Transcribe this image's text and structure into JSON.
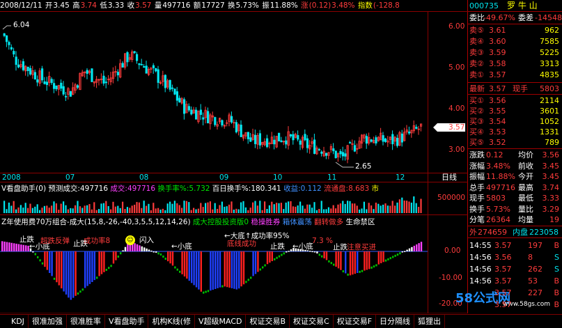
{
  "header": {
    "date": "2008/12/11",
    "open_label": "开",
    "open": "3.45",
    "high_label": "高",
    "high": "3.74",
    "low_label": "低",
    "low": "3.33",
    "close_label": "收",
    "close": "3.57",
    "vol_label": "量",
    "vol": "497716",
    "amount_label": "额",
    "amount": "17727",
    "turnover_label": "换",
    "turnover": "5.73%",
    "amplitude_label": "振",
    "amplitude": "11.88%",
    "change_label": "涨",
    "change": "(0.12)",
    "change_pct": "3.48%",
    "index_label": "指数",
    "index_val": "(-128.8",
    "stock_name": "罗 牛 山"
  },
  "price_axis": [
    "6.00",
    "5.00",
    "4.00",
    "3.00"
  ],
  "price_markers": {
    "high": "6.04",
    "low": "2.65",
    "current": "3.57"
  },
  "time_axis": [
    "2008",
    "07",
    "08",
    "09",
    "10",
    "11",
    "12"
  ],
  "line_button": "日线",
  "volume_bar": {
    "name": "V看盘助手(0)",
    "forecast_label": "预测成交:",
    "forecast": "497716",
    "deal_label": "成交:",
    "deal": "497716",
    "hand_label": "换手率%:",
    "hand": "5.732",
    "day100_label": "百日换手%:",
    "day100": "180.341",
    "profit_label": "收益:",
    "profit": "0.112",
    "float_label": "流通盘:",
    "float": "8.683",
    "market": "市",
    "axis": "500000"
  },
  "indicator": {
    "title": "Z年使用费70万组合-成大(15,8,-26,-40,3,5,5,12,14,26)",
    "t1": "成大控股投资版0",
    "t2": "稳操胜券",
    "t3": "箱体震荡",
    "t4": "翻转做多",
    "t5": "生命禁区",
    "axis": [
      "0.00",
      "-10.00",
      "-20.00"
    ],
    "notes": [
      {
        "t": "止跌",
        "c": "white"
      },
      {
        "t": "←小底",
        "c": "white"
      },
      {
        "t": "超跌反弹",
        "c": "red"
      },
      {
        "t": "成功率8",
        "c": "red"
      },
      {
        "t": "止跌",
        "c": "white"
      },
      {
        "t": "闪入",
        "c": "white"
      },
      {
        "t": "←小底",
        "c": "white"
      },
      {
        "t": "←大底↑成功率95%",
        "c": "white"
      },
      {
        "t": "底线成功",
        "c": "red"
      },
      {
        "t": "止跌",
        "c": "white"
      },
      {
        "t": "←小底",
        "c": "white"
      },
      {
        "t": "7.3 %",
        "c": "red"
      },
      {
        "t": "止跌",
        "c": "white"
      },
      {
        "t": "注意买进",
        "c": "red"
      }
    ]
  },
  "quote": {
    "code": "000735",
    "name": "罗 牛 山",
    "ratio_label": "委比",
    "ratio": "-49.67%",
    "diff_label": "委差",
    "diff": "-14548",
    "asks": [
      {
        "label": "卖⑤",
        "price": "3.61",
        "vol": "962"
      },
      {
        "label": "卖④",
        "price": "3.60",
        "vol": "7585"
      },
      {
        "label": "卖③",
        "price": "3.59",
        "vol": "5225"
      },
      {
        "label": "卖②",
        "price": "3.58",
        "vol": "3313"
      },
      {
        "label": "卖①",
        "price": "3.57",
        "vol": "4835"
      }
    ],
    "last_label": "最新",
    "last": "3.57",
    "now_label": "现手",
    "now": "5803",
    "bids": [
      {
        "label": "买①",
        "price": "3.56",
        "vol": "2114"
      },
      {
        "label": "买②",
        "price": "3.55",
        "vol": "3601"
      },
      {
        "label": "买③",
        "price": "3.54",
        "vol": "1052"
      },
      {
        "label": "买④",
        "price": "3.53",
        "vol": "1331"
      },
      {
        "label": "买⑤",
        "price": "3.52",
        "vol": "789"
      }
    ],
    "stats": [
      {
        "l1": "涨跌",
        "v1": "0.12",
        "l2": "均价",
        "v2": "3.56"
      },
      {
        "l1": "涨幅",
        "v1": "3.48%",
        "l2": "前收",
        "v2": "3.45"
      },
      {
        "l1": "振幅",
        "v1": "11.88%",
        "l2": "今开",
        "v2": "3.45"
      },
      {
        "l1": "总手",
        "v1": "497716",
        "l2": "最高",
        "v2": "3.74"
      },
      {
        "l1": "现手",
        "v1": "5803",
        "l2": "最低",
        "v2": "3.33"
      },
      {
        "l1": "换手",
        "v1": "5.73%",
        "l2": "量比",
        "v2": "3.29"
      },
      {
        "l1": "分笔",
        "v1": "26364",
        "l2": "均量",
        "v2": "19"
      }
    ],
    "outer_label": "外",
    "outer": "274659",
    "inner_label": "内盘",
    "inner": "223058",
    "ticks": [
      {
        "time": "14:55",
        "price": "3.57",
        "vol": "197",
        "bs": "B"
      },
      {
        "time": "14:56",
        "price": "3.56",
        "vol": "8",
        "bs": "S"
      },
      {
        "time": "14:56",
        "price": "3.57",
        "vol": "262",
        "bs": "S"
      },
      {
        "time": "14:56",
        "price": "3.57",
        "vol": "53",
        "bs": "B"
      },
      {
        "time": "",
        "price": "3.57",
        "vol": "227",
        "bs": "B"
      },
      {
        "time": "",
        "price": "3.57",
        "vol": "",
        "bs": "B"
      }
    ]
  },
  "tabs": [
    "KDJ",
    "很准加强",
    "很准胜率",
    "V看盘助手",
    "机构K线(修",
    "V超级MACD",
    "权证交易B",
    "权证交易C",
    "权证交易F",
    "日分隔线",
    "狐狸出"
  ],
  "watermark": {
    "text": "58公式网",
    "url": "www.58gs.com"
  },
  "colors": {
    "up": "#ff3c3c",
    "down": "#00e5ee",
    "grid": "#8b0000"
  }
}
